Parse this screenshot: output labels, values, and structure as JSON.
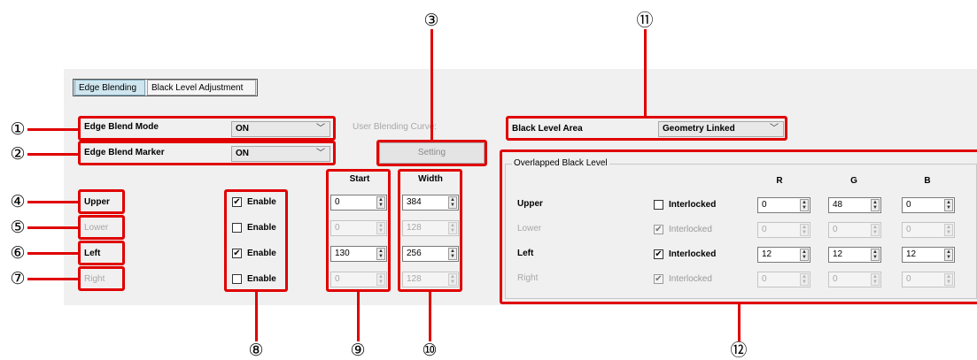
{
  "tabs": [
    {
      "label": "Edge Blending",
      "active": true
    },
    {
      "label": "Black Level Adjustment",
      "active": false
    }
  ],
  "edge_blend_mode": {
    "label": "Edge Blend Mode",
    "value": "ON"
  },
  "edge_blend_marker": {
    "label": "Edge Blend Marker",
    "value": "ON"
  },
  "user_blending_curve": {
    "label": "User Blending Curve:",
    "button": "Setting"
  },
  "black_level_area": {
    "label": "Black Level Area",
    "value": "Geometry Linked"
  },
  "columns": {
    "start": "Start",
    "width": "Width"
  },
  "edges": [
    {
      "label": "Upper",
      "enabled": true,
      "check_label": "Enable",
      "start": "0",
      "width": "384",
      "disabled": false
    },
    {
      "label": "Lower",
      "enabled": false,
      "check_label": "Enable",
      "start": "0",
      "width": "128",
      "disabled": true
    },
    {
      "label": "Left",
      "enabled": true,
      "check_label": "Enable",
      "start": "130",
      "width": "256",
      "disabled": false
    },
    {
      "label": "Right",
      "enabled": false,
      "check_label": "Enable",
      "start": "0",
      "width": "128",
      "disabled": true
    }
  ],
  "overlapped": {
    "title": "Overlapped Black Level",
    "headers": [
      "R",
      "G",
      "B"
    ],
    "rows": [
      {
        "label": "Upper",
        "interlocked": false,
        "check_label": "Interlocked",
        "r": "0",
        "g": "48",
        "b": "0",
        "disabled": false
      },
      {
        "label": "Lower",
        "interlocked": true,
        "check_label": "Interlocked",
        "r": "0",
        "g": "0",
        "b": "0",
        "disabled": true
      },
      {
        "label": "Left",
        "interlocked": true,
        "check_label": "Interlocked",
        "r": "12",
        "g": "12",
        "b": "12",
        "disabled": false
      },
      {
        "label": "Right",
        "interlocked": true,
        "check_label": "Interlocked",
        "r": "0",
        "g": "0",
        "b": "0",
        "disabled": true
      }
    ]
  },
  "callouts": [
    "①",
    "②",
    "③",
    "④",
    "⑤",
    "⑥",
    "⑦",
    "⑧",
    "⑨",
    "⑩",
    "⑪",
    "⑫"
  ],
  "glyphs": {
    "check": "✔",
    "chevron": "﹀",
    "up": "▲",
    "down": "▼"
  },
  "colors": {
    "annotation": "#e00000",
    "active_tab": "#cfe6ef",
    "panel": "#f0f0f0"
  }
}
